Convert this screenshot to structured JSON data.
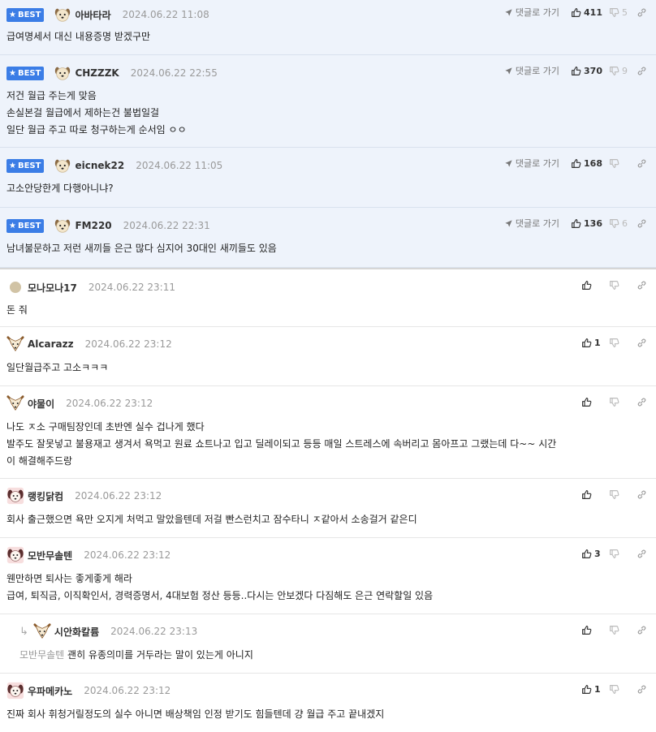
{
  "best_badge": "BEST",
  "goto_label": "댓글로 가기",
  "comments": [
    {
      "nick": "아바타라",
      "date": "2024.06.22 11:08",
      "likes": "411",
      "dislikes": "5",
      "body": "급여명세서 대신 내용증명 받겠구만"
    },
    {
      "nick": "CHZZZK",
      "date": "2024.06.22 22:55",
      "likes": "370",
      "dislikes": "9",
      "body": "저건 월급 주는게 맞음\n손실본걸 월급에서 제하는건 불법일걸\n일단 월급 주고 따로 청구하는게 순서임 ㅇㅇ"
    },
    {
      "nick": "eicnek22",
      "date": "2024.06.22 11:05",
      "likes": "168",
      "dislikes": "",
      "body": "고소안당한게 다행아니냐?"
    },
    {
      "nick": "FM220",
      "date": "2024.06.22 22:31",
      "likes": "136",
      "dislikes": "6",
      "body": "남녀불문하고 저런 새끼들 은근 많다 심지어 30대인 새끼들도 있음"
    },
    {
      "nick": "모나모나17",
      "date": "2024.06.22 23:11",
      "likes": "",
      "dislikes": "",
      "body": "돈 줘"
    },
    {
      "nick": "Alcarazz",
      "date": "2024.06.22 23:12",
      "likes": "1",
      "dislikes": "",
      "body": "일단월급주고 고소ㅋㅋㅋ"
    },
    {
      "nick": "야물이",
      "date": "2024.06.22 23:12",
      "likes": "",
      "dislikes": "",
      "body": "나도 ㅈ소 구매팀장인데 초반엔 실수 겁나게 했다\n발주도 잘못넣고 불용재고 생겨서 욕먹고 원료 쇼트나고 입고 딜레이되고 등등 매일 스트레스에 속버리고 몸아프고 그랬는데 다~~ 시간\n이 해결해주드랑"
    },
    {
      "nick": "랭킹닭컴",
      "date": "2024.06.22 23:12",
      "likes": "",
      "dislikes": "",
      "body": "회사 출근했으면 욕만 오지게 처먹고 말았을텐데 저걸 빤스런치고 잠수타니 ㅈ같아서 소송걸거 같은디"
    },
    {
      "nick": "모반무솔텐",
      "date": "2024.06.22 23:12",
      "likes": "3",
      "dislikes": "",
      "body": "웬만하면 퇴사는 좋게좋게 해라\n급여, 퇴직금, 이직확인서, 경력증명서, 4대보험 정산 등등..다시는 안보겠다 다짐해도 은근 연락할일 있음"
    },
    {
      "nick": "시안화칼륨",
      "date": "2024.06.22 23:13",
      "likes": "",
      "dislikes": "",
      "mention": "모반무솔텐",
      "body": "괜히 유종의미를 거두라는 말이 있는게 아니지"
    },
    {
      "nick": "우파메카노",
      "date": "2024.06.22 23:12",
      "likes": "1",
      "dislikes": "",
      "body": "진짜 회사 휘청거릴정도의 실수 아니면 배상책임 인정 받기도 힘들텐데 걍 월급 주고 끝내겠지"
    }
  ]
}
